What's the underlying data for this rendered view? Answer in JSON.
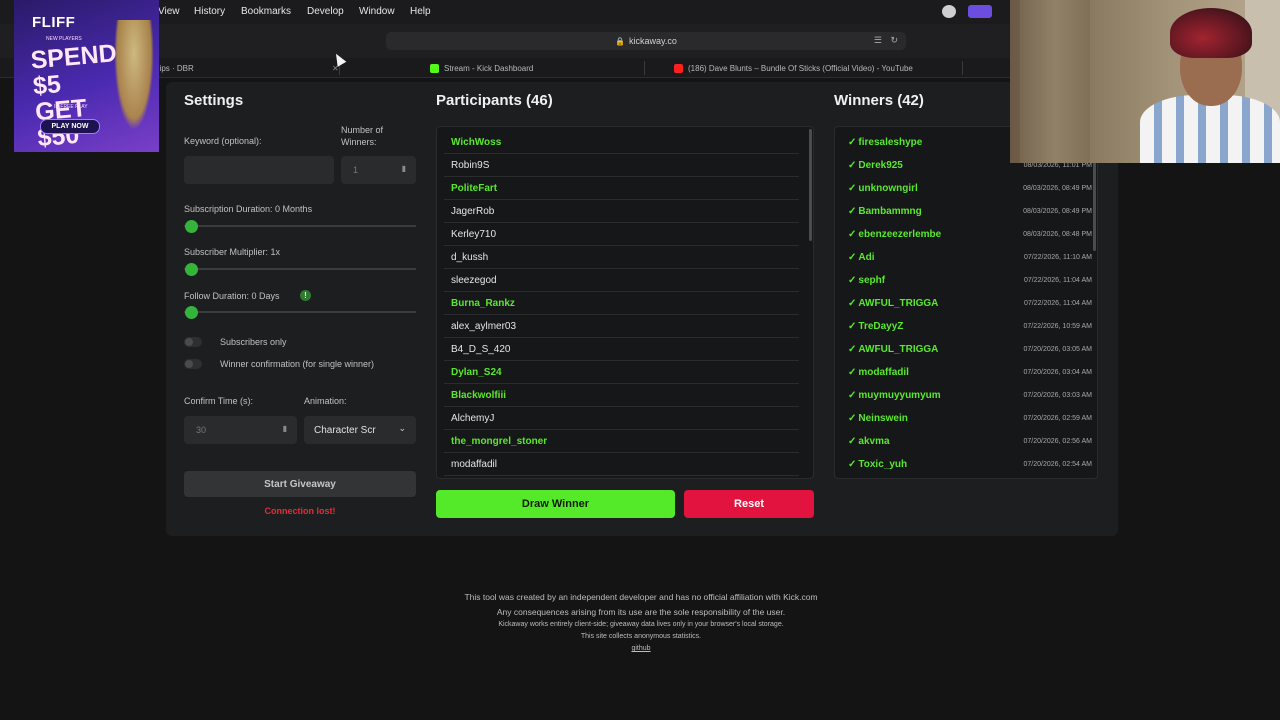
{
  "menubar": {
    "items": [
      "View",
      "History",
      "Bookmarks",
      "Develop",
      "Window",
      "Help"
    ]
  },
  "browser": {
    "url": "kickaway.co",
    "tabs": [
      {
        "label": "Clips · DBR",
        "icon": "clips-favicon"
      },
      {
        "label": "Stream - Kick Dashboard",
        "icon": "kick-favicon"
      },
      {
        "label": "(186) Dave Blunts – Bundle Of Sticks (Official Video) - YouTube",
        "icon": "youtube-favicon"
      }
    ]
  },
  "ad": {
    "brand": "FLIFF",
    "new_players": "NEW PLAYERS",
    "headline": "SPEND $5 GET $50",
    "fine_print": "IN FREE PLAY",
    "cta": "PLAY NOW"
  },
  "settings": {
    "title": "Settings",
    "keyword_label": "Keyword (optional):",
    "keyword_value": "",
    "winners_label": "Number of Winners:",
    "winners_value": "1",
    "sub_duration_label": "Subscription Duration: 0 Months",
    "sub_multiplier_label": "Subscriber Multiplier: 1x",
    "follow_duration_label": "Follow Duration:  0  Days",
    "subscribers_only_label": "Subscribers only",
    "winner_confirm_label": "Winner confirmation (for single winner)",
    "confirm_time_label": "Confirm Time (s):",
    "confirm_time_value": "30",
    "animation_label": "Animation:",
    "animation_value": "Character Scr",
    "start_label": "Start Giveaway",
    "connection_status": "Connection lost!"
  },
  "participants": {
    "title": "Participants (46)",
    "items": [
      {
        "name": "WichWoss",
        "highlight": true
      },
      {
        "name": "Robin9S",
        "highlight": false
      },
      {
        "name": "PoliteFart",
        "highlight": true
      },
      {
        "name": "JagerRob",
        "highlight": false
      },
      {
        "name": "Kerley710",
        "highlight": false
      },
      {
        "name": "d_kussh",
        "highlight": false
      },
      {
        "name": "sleezegod",
        "highlight": false
      },
      {
        "name": "Burna_Rankz",
        "highlight": true
      },
      {
        "name": "alex_aylmer03",
        "highlight": false
      },
      {
        "name": "B4_D_S_420",
        "highlight": false
      },
      {
        "name": "Dylan_S24",
        "highlight": true
      },
      {
        "name": "Blackwolfiii",
        "highlight": true
      },
      {
        "name": "AlchemyJ",
        "highlight": false
      },
      {
        "name": "the_mongrel_stoner",
        "highlight": true
      },
      {
        "name": "modaffadil",
        "highlight": false
      }
    ]
  },
  "winners": {
    "title": "Winners (42)",
    "items": [
      {
        "name": "firesaleshype",
        "time": "08/"
      },
      {
        "name": "Derek925",
        "time": "08/03/2026, 11:01 PM"
      },
      {
        "name": "unknowngirl",
        "time": "08/03/2026, 08:49 PM"
      },
      {
        "name": "Bambammng",
        "time": "08/03/2026, 08:49 PM"
      },
      {
        "name": "ebenzeezerlembe",
        "time": "08/03/2026, 08:48 PM"
      },
      {
        "name": "Adi",
        "time": "07/22/2026, 11:10 AM"
      },
      {
        "name": "sephf",
        "time": "07/22/2026, 11:04 AM"
      },
      {
        "name": "AWFUL_TRIGGA",
        "time": "07/22/2026, 11:04 AM"
      },
      {
        "name": "TreDayyZ",
        "time": "07/22/2026, 10:59 AM"
      },
      {
        "name": "AWFUL_TRIGGA",
        "time": "07/20/2026, 03:05 AM"
      },
      {
        "name": "modaffadil",
        "time": "07/20/2026, 03:04 AM"
      },
      {
        "name": "muymuyyumyum",
        "time": "07/20/2026, 03:03 AM"
      },
      {
        "name": "Neinswein",
        "time": "07/20/2026, 02:59 AM"
      },
      {
        "name": "akvma",
        "time": "07/20/2026, 02:56 AM"
      },
      {
        "name": "Toxic_yuh",
        "time": "07/20/2026, 02:54 AM"
      }
    ]
  },
  "actions": {
    "draw": "Draw Winner",
    "reset": "Reset"
  },
  "footer": {
    "line1": "This tool was created by an independent developer and has no official affiliation with Kick.com",
    "line2": "Any consequences arising from its use are the sole responsibility of the user.",
    "line3": "Kickaway works entirely client-side; giveaway data lives only in your browser's local storage.",
    "line4": "This site collects anonymous statistics.",
    "link": "github"
  },
  "colors": {
    "accent_green": "#59e82f",
    "draw_button": "#54ea2a",
    "reset_button": "#e2133e",
    "error_text": "#e02f3a"
  }
}
